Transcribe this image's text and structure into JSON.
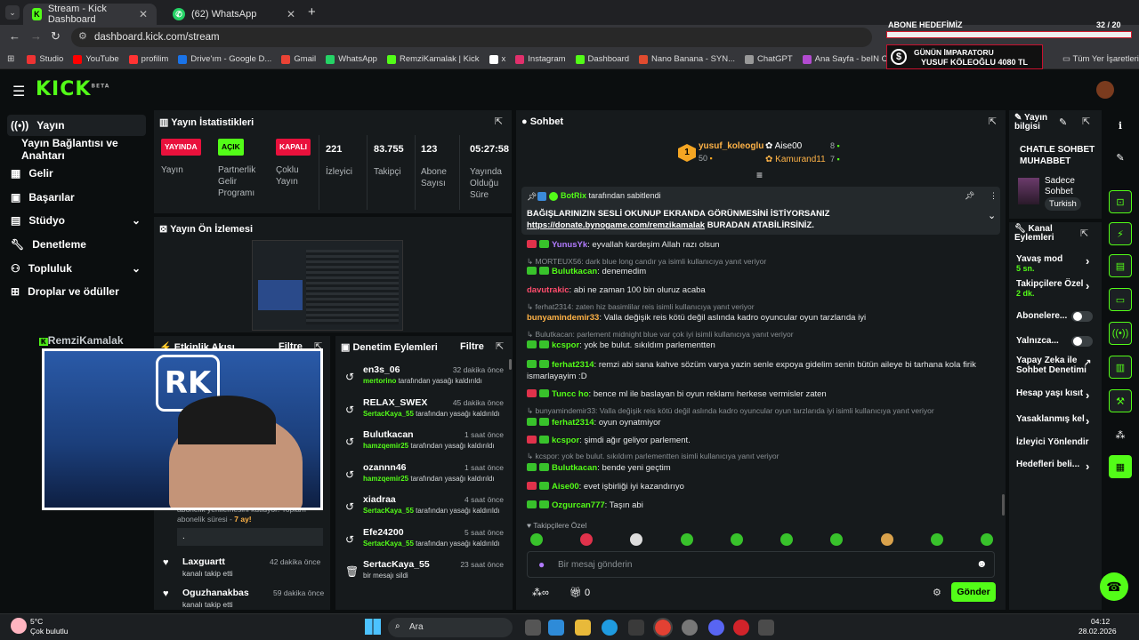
{
  "browser": {
    "tabs": [
      {
        "title": "Stream - Kick Dashboard"
      },
      {
        "title": "(62) WhatsApp"
      }
    ],
    "url": "dashboard.kick.com/stream",
    "bookmarks": [
      "Studio",
      "YouTube",
      "profilim",
      "Drive'ım - Google D...",
      "Gmail",
      "WhatsApp",
      "RemziKamalak | Kick",
      "x",
      "Instagram",
      "Dashboard",
      "Nano Banana - SYN...",
      "ChatGPT",
      "Ana Sayfa - beIN C..."
    ],
    "all_bookmarks": "Tüm Yer İşaretleri"
  },
  "overlay": {
    "goal_label": "ABONE HEDEFİMİZ",
    "goal_count": "32",
    "goal_total": "/ 20",
    "goal_progress": 1.0,
    "emperor_label": "GÜNÜN İMPARATORU",
    "emperor_value": "YUSUF KÖLEOĞLU 4080 TL"
  },
  "sidebar": {
    "items": [
      {
        "label": "Yayın",
        "icon": "broadcast-icon"
      },
      {
        "label": "Yayın Bağlantısı ve Anahtarı",
        "icon": ""
      },
      {
        "label": "Gelir",
        "icon": "revenue-icon"
      },
      {
        "label": "Başarılar",
        "icon": "trophy-icon"
      },
      {
        "label": "Stüdyo",
        "icon": "studio-icon"
      },
      {
        "label": "Denetleme",
        "icon": "wrench-icon"
      },
      {
        "label": "Topluluk",
        "icon": "community-icon"
      },
      {
        "label": "Droplar ve ödüller",
        "icon": "gift-icon"
      }
    ]
  },
  "stats": {
    "title": "Yayın İstatistikleri",
    "items": [
      {
        "badge": "YAYINDA",
        "label": "Yayın"
      },
      {
        "badge": "AÇIK",
        "label": "Partnerlik Gelir Programı"
      },
      {
        "badge": "KAPALI",
        "label": "Çoklu Yayın"
      },
      {
        "value": "221",
        "label": "İzleyici"
      },
      {
        "value": "83.755",
        "label": "Takipçi"
      },
      {
        "value": "123",
        "label": "Abone Sayısı"
      },
      {
        "value": "05:27:58",
        "label": "Yayında Olduğu Süre"
      }
    ]
  },
  "preview": {
    "title": "Yayın Ön İzlemesi"
  },
  "webcam": {
    "name": "RemziKamalak"
  },
  "activity": {
    "title": "Etkinlik Akışı",
    "filter": "Filtre",
    "sub_text": "abonelik yenilemesini kutluyor! Toplam abonelik süresi -",
    "sub_months": "7 ay!",
    "sub_message": ".",
    "follows": [
      {
        "user": "Laxguartt",
        "text": "kanalı takip etti",
        "time": "42 dakika önce"
      },
      {
        "user": "Oguzhanakbas",
        "text": "kanalı takip etti",
        "time": "59 dakika önce"
      }
    ]
  },
  "moderation": {
    "title": "Denetim Eylemleri",
    "filter": "Filtre",
    "items": [
      {
        "user": "en3s_06",
        "time": "32 dakika önce",
        "by": "mertorino",
        "action": "tarafından yasağı kaldırıldı"
      },
      {
        "user": "RELAX_SWEX",
        "time": "45 dakika önce",
        "by": "SertacKaya_55",
        "action": "tarafından yasağı kaldırıldı"
      },
      {
        "user": "Bulutkacan",
        "time": "1 saat önce",
        "by": "hamzqemir25",
        "action": "tarafından yasağı kaldırıldı"
      },
      {
        "user": "ozannn46",
        "time": "1 saat önce",
        "by": "hamzqemir25",
        "action": "tarafından yasağı kaldırıldı"
      },
      {
        "user": "xiadraa",
        "time": "4 saat önce",
        "by": "SertacKaya_55",
        "action": "tarafından yasağı kaldırıldı"
      },
      {
        "user": "Efe24200",
        "time": "5 saat önce",
        "by": "SertacKaya_55",
        "action": "tarafından yasağı kaldırıldı"
      },
      {
        "user": "SertacKaya_55",
        "time": "23 saat önce",
        "by": "",
        "action": "bir mesajı sildi"
      }
    ]
  },
  "chat": {
    "title": "Sohbet",
    "top_gifters": [
      {
        "name": "yusuf_koleoglu",
        "count": "50",
        "rank": "1"
      },
      {
        "name": "Aise00",
        "count": "8"
      },
      {
        "name": "Kamurand11",
        "count": "7"
      }
    ],
    "pinned_by": "BotRix",
    "pinned_by_text": "tarafından sabitlendi",
    "pinned_text": "BAĞIŞLARINIZIN SESLİ OKUNUP EKRANDA GÖRÜNMESİNİ İSTİYORSANIZ",
    "pinned_link": "https://donate.bynogame.com/remzikamalak",
    "pinned_suffix": "BURADAN ATABİLİRSİNİZ.",
    "messages": [
      {
        "user": "YunusYk",
        "color": "#b27bff",
        "text": "eyvallah kardeşim Allah razı olsun"
      },
      {
        "reply": "MORTEUX56: dark blue long candır ya isimli kullanıcıya yanıt veriyor"
      },
      {
        "user": "Bulutkacan",
        "color": "#53fc18",
        "text": "denemedim"
      },
      {
        "user": "davutrakic",
        "color": "#ff4d6d",
        "text": "abi ne zaman 100 bin oluruz acaba"
      },
      {
        "reply": "ferhat2314: zaten hiz basimlilar reis isimli kullanıcıya yanıt veriyor"
      },
      {
        "user": "bunyamindemir33",
        "color": "#ffb347",
        "text": "Valla değişik reis kötü değil aslında kadro oyuncular oyun tarzlarıda iyi"
      },
      {
        "reply": "Bulutkacan: parlement midnight blue var çok iyi isimli kullanıcıya yanıt veriyor"
      },
      {
        "user": "kcspor",
        "color": "#53fc18",
        "text": "yok be bulut. sıkıldım parlementten"
      },
      {
        "user": "ferhat2314",
        "color": "#53fc18",
        "text": "remzi abi sana kahve sözüm varya yazin senle expoya gidelim senin bütün aileye bi tarhana kola firik ismarlayayim :D"
      },
      {
        "user": "Tuncc ho",
        "color": "#53fc18",
        "text": "bence ml ile baslayan bi oyun reklamı herkese vermisler zaten"
      },
      {
        "reply": "bunyamindemir33: Valla değişik reis kötü değil aslında kadro oyuncular oyun tarzlarıda iyi isimli kullanıcıya yanıt veriyor"
      },
      {
        "user": "ferhat2314",
        "color": "#53fc18",
        "text": "oyun oynatmiyor"
      },
      {
        "user": "kcspor",
        "color": "#53fc18",
        "text": "şimdi ağır geliyor parlement."
      },
      {
        "reply": "kcspor: yok be bulut. sıkıldım parlementten isimli kullanıcıya yanıt veriyor"
      },
      {
        "user": "Bulutkacan",
        "color": "#53fc18",
        "text": "bende yeni geçtim"
      },
      {
        "user": "Aise00",
        "color": "#53fc18",
        "text": "evet işbirliği iyi kazandırıyo"
      },
      {
        "user": "Ozgurcan777",
        "color": "#53fc18",
        "text": "Taşın abi"
      }
    ],
    "followers_only": "Takipçilere Özel",
    "input_placeholder": "Bir mesaj gönderin",
    "points": "0",
    "send": "Gönder"
  },
  "stream_info": {
    "title": "Yayın bilgisi",
    "stream_title": "CHATLE SOHBET MUHABBET",
    "category": "Sadece Sohbet",
    "language": "Turkish"
  },
  "channel_actions": {
    "title": "Kanal Eylemleri",
    "items": [
      {
        "label": "Yavaş mod",
        "sub": "5 sn."
      },
      {
        "label": "Takipçilere Özel",
        "sub": "2 dk."
      },
      {
        "label": "Abonelere...",
        "sub": ""
      },
      {
        "label": "Yalnızca...",
        "sub": ""
      },
      {
        "label": "Yapay Zeka ile Sohbet Denetimi",
        "sub": ""
      },
      {
        "label": "Hesap yaşı kısıt",
        "sub": ""
      },
      {
        "label": "Yasaklanmış kel",
        "sub": ""
      },
      {
        "label": "İzleyici Yönlendir",
        "sub": ""
      },
      {
        "label": "Hedefleri beli...",
        "sub": ""
      }
    ]
  },
  "taskbar": {
    "weather_temp": "5°C",
    "weather_desc": "Çok bulutlu",
    "search": "Ara",
    "time": "04:12",
    "date": "28.02.2026"
  },
  "colors": {
    "accent": "#53fc18",
    "bg": "#0b0e0f",
    "panel": "#161a1c",
    "live": "#e9113c"
  }
}
